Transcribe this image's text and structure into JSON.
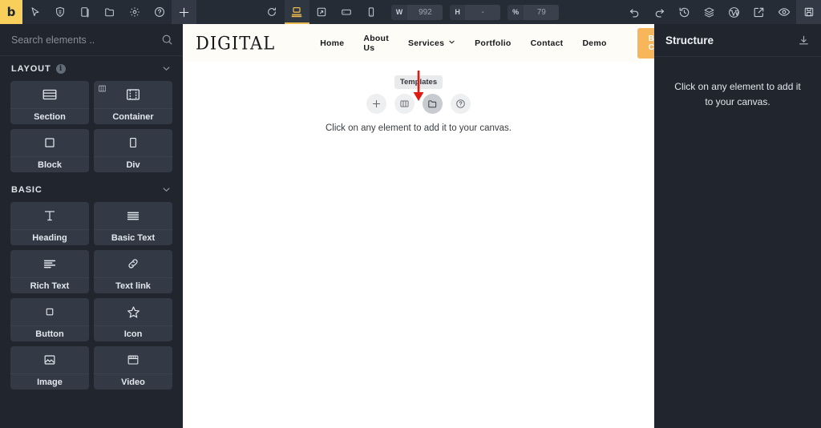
{
  "topbar": {
    "brand": "b",
    "left_tools": [
      {
        "name": "pointer-icon",
        "title": "Select"
      },
      {
        "name": "shield-icon",
        "title": "Theme"
      },
      {
        "name": "page-icon",
        "title": "Pages"
      },
      {
        "name": "folder-icon",
        "title": "Folders"
      },
      {
        "name": "gear-icon",
        "title": "Settings"
      },
      {
        "name": "help-icon",
        "title": "Help"
      },
      {
        "name": "plus-icon",
        "title": "Add"
      }
    ],
    "breakpoints": [
      {
        "name": "refresh-icon",
        "active": false
      },
      {
        "name": "desktop-icon",
        "active": true
      },
      {
        "name": "laptop-icon",
        "active": false
      },
      {
        "name": "tablet-icon",
        "active": false
      },
      {
        "name": "mobile-icon",
        "active": false
      }
    ],
    "dimensions": {
      "width_label": "W",
      "width_value": "992",
      "height_label": "H",
      "height_value": "-",
      "zoom_label": "%",
      "zoom_value": "79"
    },
    "right_tools": [
      {
        "name": "undo-icon"
      },
      {
        "name": "redo-icon"
      },
      {
        "name": "history-icon"
      },
      {
        "name": "layers-icon"
      },
      {
        "name": "wordpress-icon"
      },
      {
        "name": "external-link-icon"
      },
      {
        "name": "preview-eye-icon"
      },
      {
        "name": "save-icon"
      }
    ],
    "accent_color": "#f7cf5a",
    "active_color": "#e9b84e"
  },
  "left_panel": {
    "search": {
      "placeholder": "Search elements ..",
      "value": "",
      "icon": "search-icon"
    },
    "sections": [
      {
        "title": "LAYOUT",
        "has_info": true,
        "info_glyph": "i",
        "collapsed": false,
        "items": [
          {
            "label": "Section",
            "icon": "section-icon",
            "corner": false
          },
          {
            "label": "Container",
            "icon": "container-icon",
            "corner": true
          },
          {
            "label": "Block",
            "icon": "block-icon",
            "corner": false
          },
          {
            "label": "Div",
            "icon": "div-icon",
            "corner": false
          }
        ]
      },
      {
        "title": "BASIC",
        "has_info": false,
        "collapsed": false,
        "items": [
          {
            "label": "Heading",
            "icon": "heading-icon",
            "corner": false
          },
          {
            "label": "Basic Text",
            "icon": "basic-text-icon",
            "corner": false
          },
          {
            "label": "Rich Text",
            "icon": "rich-text-icon",
            "corner": false
          },
          {
            "label": "Text link",
            "icon": "text-link-icon",
            "corner": false
          },
          {
            "label": "Button",
            "icon": "button-icon",
            "corner": false
          },
          {
            "label": "Icon",
            "icon": "star-icon",
            "corner": false
          },
          {
            "label": "Image",
            "icon": "image-icon",
            "corner": false
          },
          {
            "label": "Video",
            "icon": "video-icon",
            "corner": false
          }
        ]
      }
    ]
  },
  "canvas": {
    "site": {
      "logo": "DIGITAL",
      "nav": [
        {
          "label": "Home",
          "has_caret": false
        },
        {
          "label": "About Us",
          "has_caret": false
        },
        {
          "label": "Services",
          "has_caret": true
        },
        {
          "label": "Portfolio",
          "has_caret": false
        },
        {
          "label": "Contact",
          "has_caret": false
        },
        {
          "label": "Demo",
          "has_caret": false
        }
      ],
      "cta_label": "Book Consultation",
      "cta_color": "#f7b65a",
      "background": "#fdfcf6"
    },
    "element_picker": {
      "tooltip": "Templates",
      "arrow_color": "#e01b12",
      "buttons": [
        {
          "name": "add-element-button",
          "icon": "plus-icon",
          "active": false
        },
        {
          "name": "columns-button",
          "icon": "columns-icon",
          "active": false
        },
        {
          "name": "templates-button",
          "icon": "folder-icon",
          "active": true
        },
        {
          "name": "help-button",
          "icon": "help-icon",
          "active": false
        }
      ],
      "hint": "Click on any element to add it to your canvas."
    }
  },
  "right_panel": {
    "title": "Structure",
    "download_icon": "download-icon",
    "empty_message": "Click on any element to add it to your canvas."
  }
}
